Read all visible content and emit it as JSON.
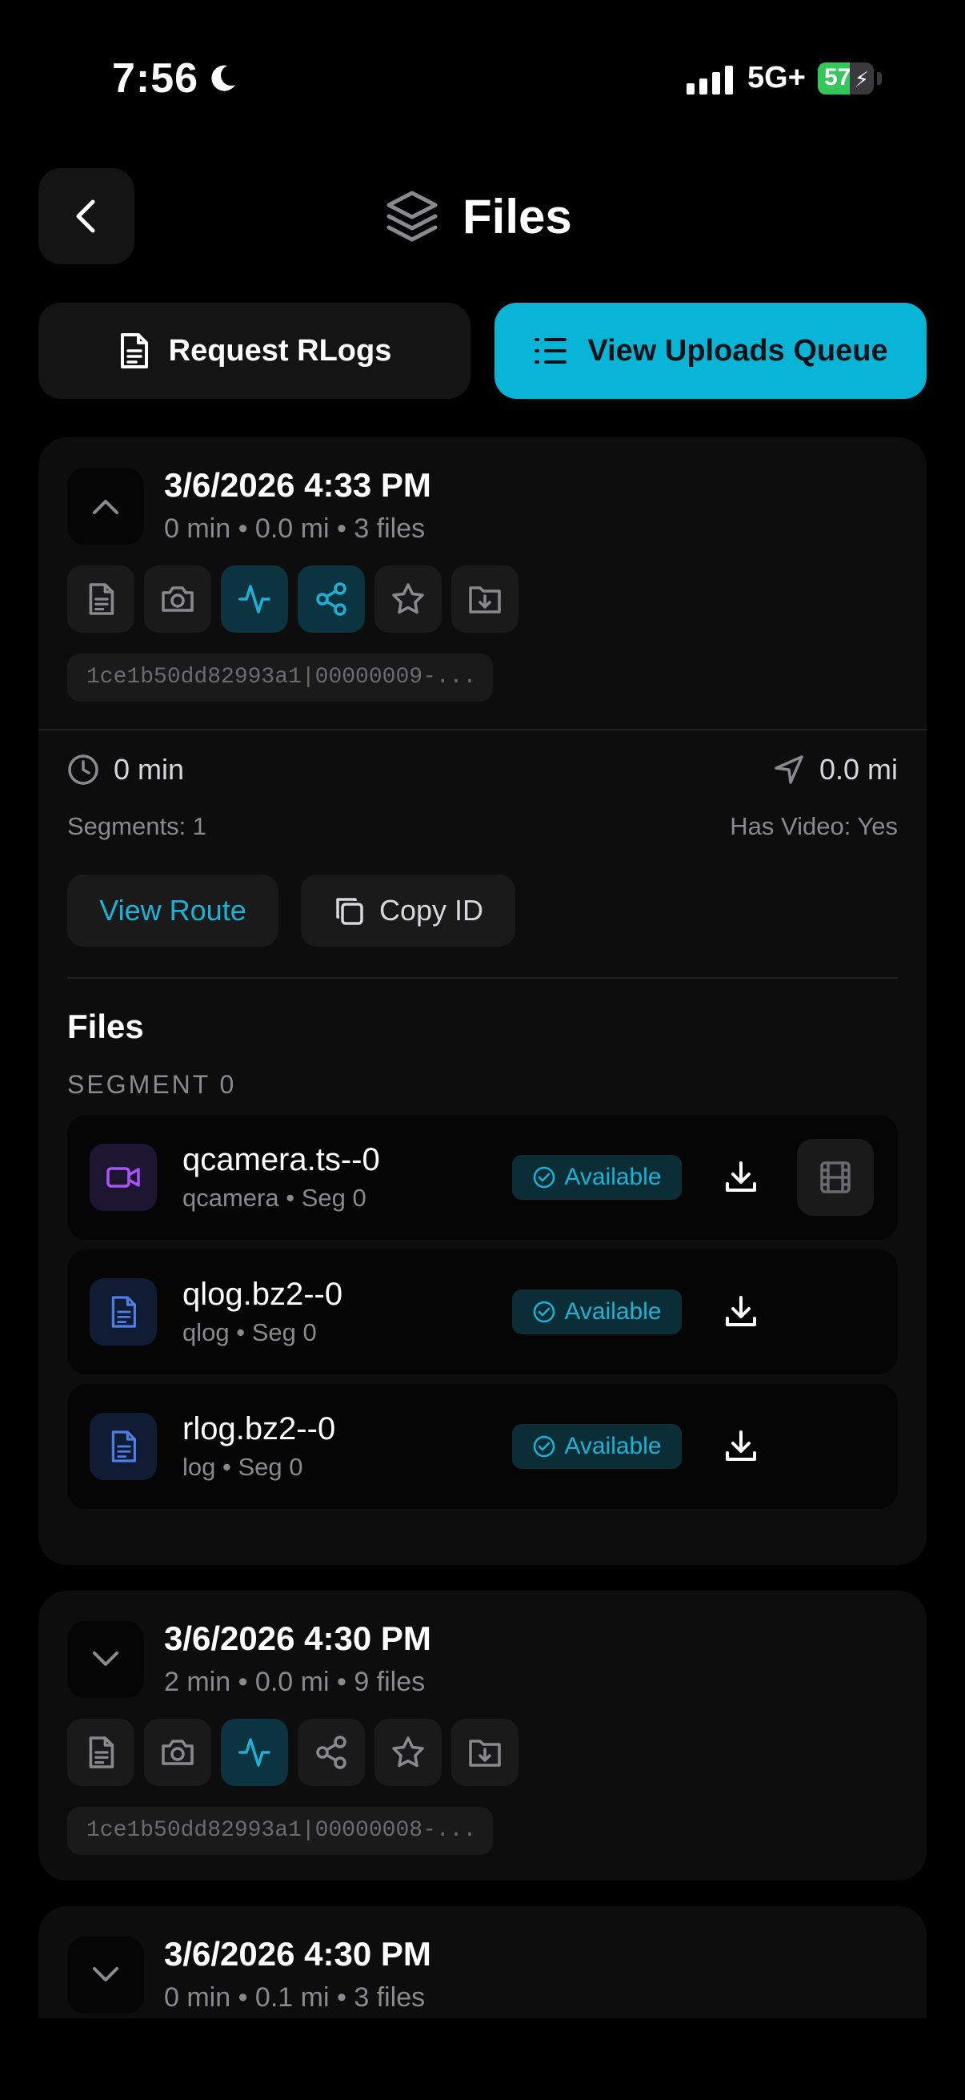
{
  "status_bar": {
    "time": "7:56",
    "network": "5G+",
    "battery": "57",
    "battery_level": 0.57
  },
  "header": {
    "title": "Files"
  },
  "actions": {
    "request_rlogs": "Request RLogs",
    "view_uploads_queue": "View Uploads Queue"
  },
  "routes": [
    {
      "date": "3/6/2026 4:33 PM",
      "meta": "0 min • 0.0 mi • 3 files",
      "route_id": "1ce1b50dd82993a1|00000009-...",
      "expanded": true,
      "details": {
        "duration": "0 min",
        "distance": "0.0 mi",
        "segments": "Segments: 1",
        "has_video": "Has Video: Yes",
        "view_route": "View Route",
        "copy_id": "Copy ID"
      },
      "files_title": "Files",
      "segment_label": "SEGMENT 0",
      "files": [
        {
          "name": "qcamera.ts--0",
          "sub": "qcamera • Seg 0",
          "status": "Available",
          "icon": "video-icon"
        },
        {
          "name": "qlog.bz2--0",
          "sub": "qlog • Seg 0",
          "status": "Available",
          "icon": "document-icon"
        },
        {
          "name": "rlog.bz2--0",
          "sub": "log • Seg 0",
          "status": "Available",
          "icon": "document-icon"
        }
      ]
    },
    {
      "date": "3/6/2026 4:30 PM",
      "meta": "2 min • 0.0 mi • 9 files",
      "route_id": "1ce1b50dd82993a1|00000008-...",
      "expanded": false
    },
    {
      "date": "3/6/2026 4:30 PM",
      "meta": "0 min • 0.1 mi • 3 files",
      "expanded": false
    }
  ],
  "colors": {
    "accent": "#08b5d6",
    "accent_text": "#1ab3d6",
    "video_icon": "#a855f7",
    "doc_icon": "#4f7fe6"
  }
}
